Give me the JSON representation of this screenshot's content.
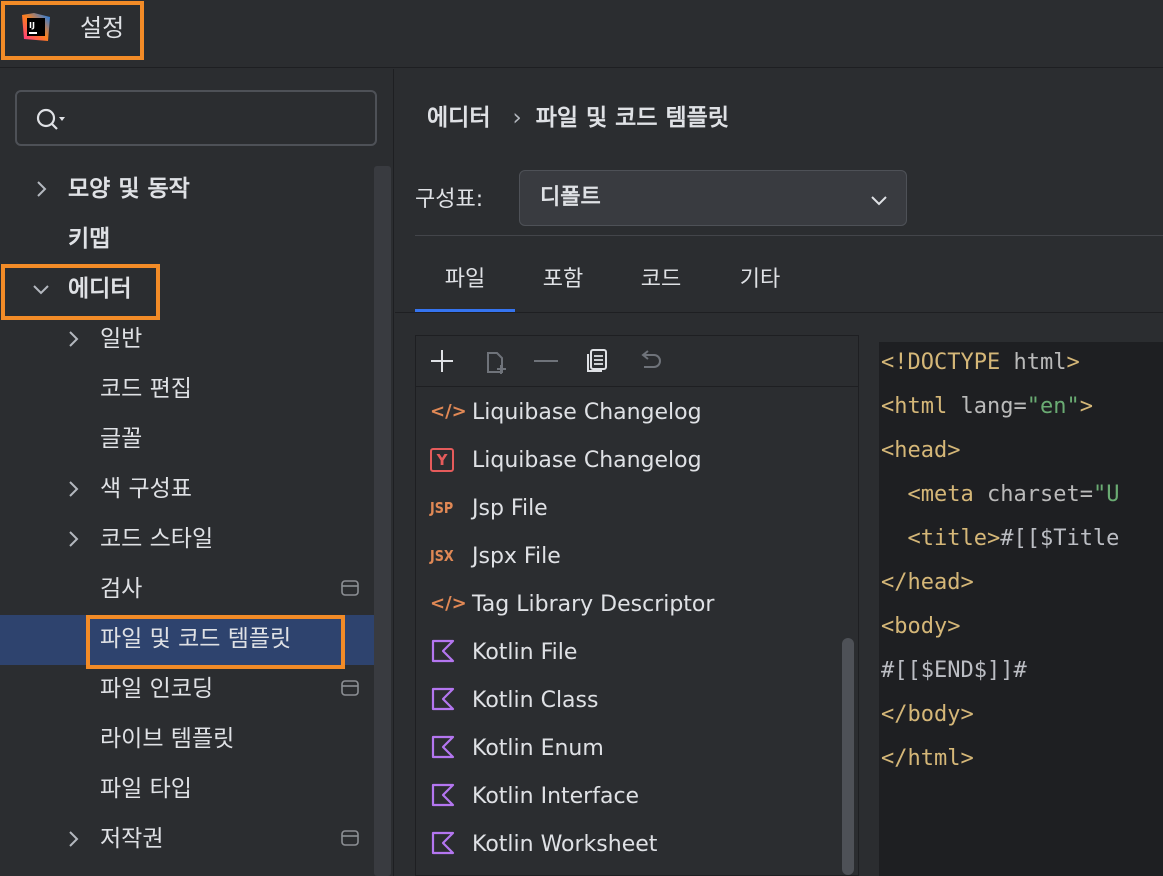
{
  "window": {
    "title": "설정"
  },
  "sidebar": {
    "search": {
      "value": "",
      "placeholder": ""
    },
    "items": [
      {
        "label": "모양 및 동작",
        "bold": true,
        "expander": "collapsed"
      },
      {
        "label": "키맵",
        "bold": true,
        "expander": "none"
      },
      {
        "label": "에디터",
        "bold": true,
        "expander": "expanded"
      },
      {
        "label": "일반",
        "bold": false,
        "expander": "collapsed"
      },
      {
        "label": "코드 편집",
        "bold": false,
        "expander": "none"
      },
      {
        "label": "글꼴",
        "bold": false,
        "expander": "none"
      },
      {
        "label": "색 구성표",
        "bold": false,
        "expander": "collapsed"
      },
      {
        "label": "코드 스타일",
        "bold": false,
        "expander": "collapsed"
      },
      {
        "label": "검사",
        "bold": false,
        "expander": "none",
        "badge": "project-scope-icon"
      },
      {
        "label": "파일 및 코드 템플릿",
        "bold": false,
        "expander": "none",
        "selected": true
      },
      {
        "label": "파일 인코딩",
        "bold": false,
        "expander": "none",
        "badge": "project-scope-icon"
      },
      {
        "label": "라이브 템플릿",
        "bold": false,
        "expander": "none"
      },
      {
        "label": "파일 타입",
        "bold": false,
        "expander": "none"
      },
      {
        "label": "저작권",
        "bold": false,
        "expander": "collapsed",
        "badge": "project-scope-icon"
      }
    ]
  },
  "content": {
    "breadcrumb": {
      "parent": "에디터",
      "separator": "›",
      "current": "파일 및 코드 템플릿"
    },
    "scheme": {
      "label": "구성표:",
      "value": "디폴트"
    },
    "tabs": [
      {
        "label": "파일",
        "active": true
      },
      {
        "label": "포함",
        "active": false
      },
      {
        "label": "코드",
        "active": false
      },
      {
        "label": "기타",
        "active": false
      }
    ],
    "toolbar": [
      "add-icon",
      "copy-icon",
      "remove-icon",
      "duplicate-icon",
      "reset-icon"
    ],
    "templates": [
      {
        "name": "Liquibase Changelog",
        "icon": "xml-icon",
        "icon_text": "</>"
      },
      {
        "name": "Liquibase Changelog",
        "icon": "yaml-icon",
        "icon_text": "Y"
      },
      {
        "name": "Jsp File",
        "icon": "jsp-icon",
        "icon_text": "JSP"
      },
      {
        "name": "Jspx File",
        "icon": "jspx-icon",
        "icon_text": "JSX"
      },
      {
        "name": "Tag Library Descriptor",
        "icon": "xml-icon",
        "icon_text": "</>"
      },
      {
        "name": "Kotlin File",
        "icon": "kotlin-icon",
        "icon_text": ""
      },
      {
        "name": "Kotlin Class",
        "icon": "kotlin-icon",
        "icon_text": ""
      },
      {
        "name": "Kotlin Enum",
        "icon": "kotlin-icon",
        "icon_text": ""
      },
      {
        "name": "Kotlin Interface",
        "icon": "kotlin-icon",
        "icon_text": ""
      },
      {
        "name": "Kotlin Worksheet",
        "icon": "kotlin-icon",
        "icon_text": ""
      }
    ],
    "code": {
      "line1": {
        "a": "<!DOCTYPE",
        "b": " html",
        "c": ">"
      },
      "line2": {
        "a": "<html",
        "b": " lang",
        "c": "=",
        "d": "\"en\"",
        "e": ">"
      },
      "line3": {
        "a": "<head>"
      },
      "line4": {
        "indent": "  ",
        "a": "<meta",
        "b": " charset",
        "c": "=",
        "d": "\"U"
      },
      "line5": {
        "indent": "  ",
        "a": "<title>",
        "b": "#[[$Title"
      },
      "line6": {
        "a": "</head>"
      },
      "line7": {
        "a": "<body>"
      },
      "line8": {
        "a": "#[[$END$]]#"
      },
      "line9": {
        "a": "</body>"
      },
      "line10": {
        "a": "</html>"
      }
    }
  },
  "colors": {
    "highlight": "#f28b27",
    "selection": "#2e436e",
    "accent": "#3574f0",
    "tag": "#d5b778",
    "string": "#6aab73",
    "kotlin": "#b476f0"
  }
}
